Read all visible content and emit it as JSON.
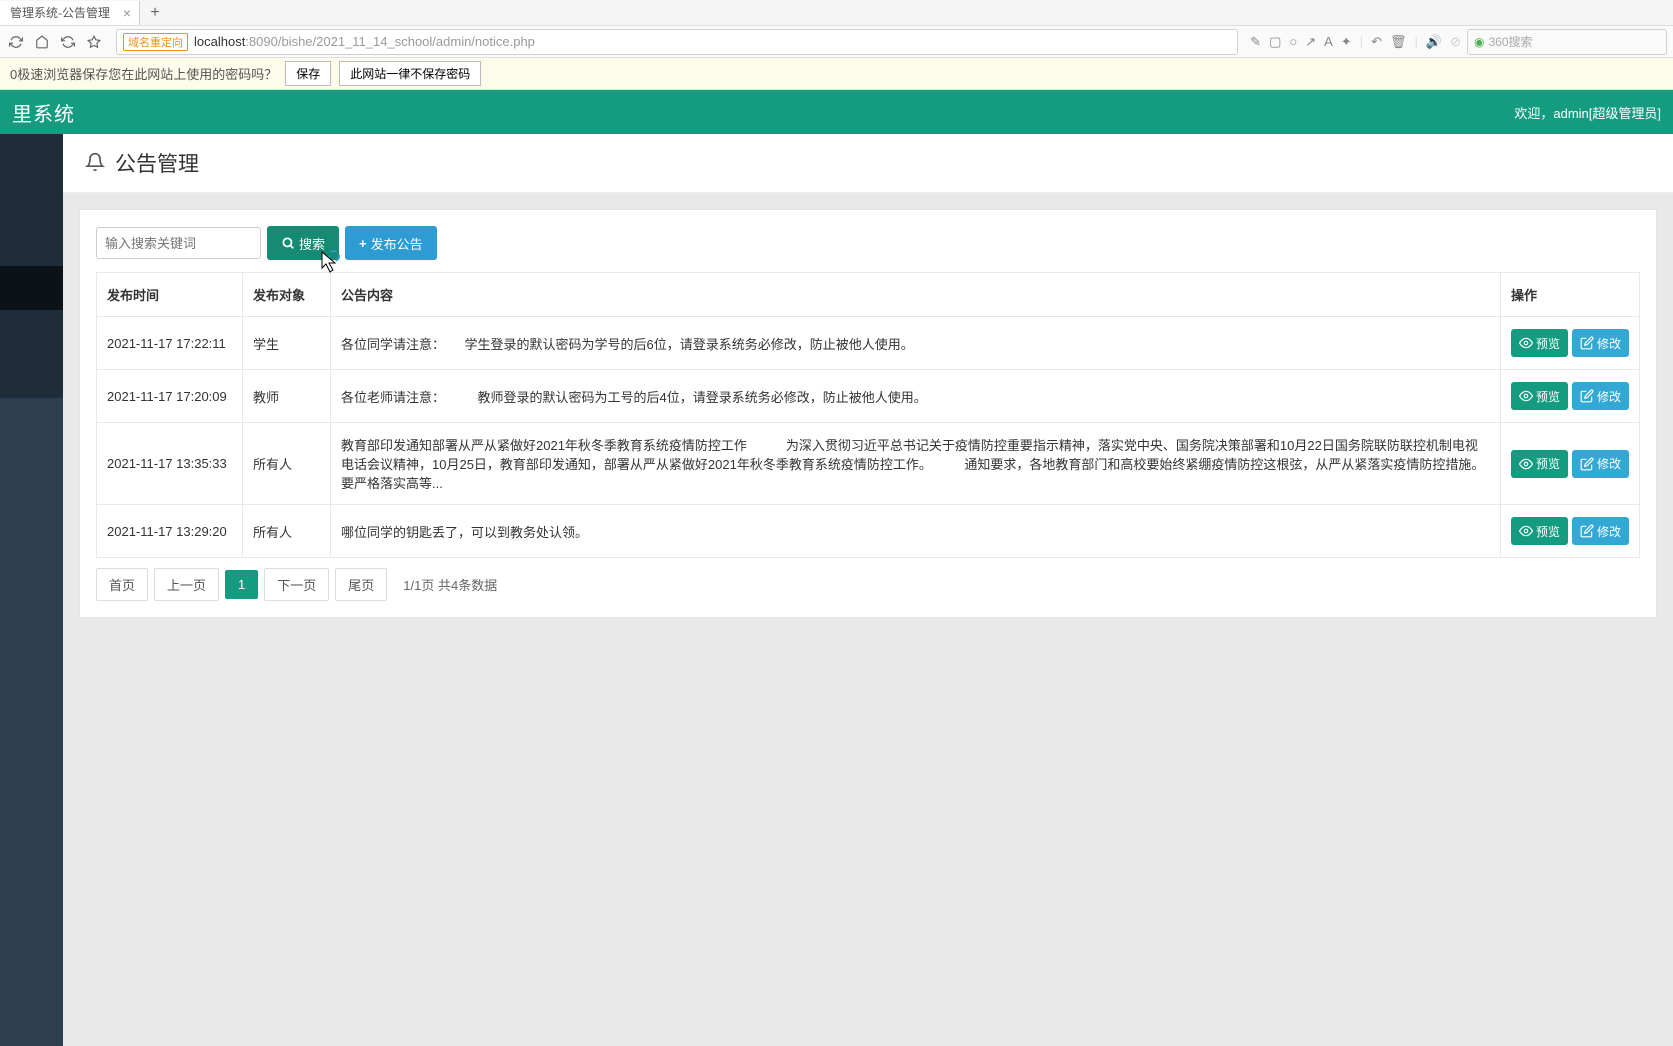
{
  "browser": {
    "tab_title": "管理系统-公告管理",
    "url_badge": "域名重定向",
    "url_host": "localhost",
    "url_path": ":8090/bishe/2021_11_14_school/admin/notice.php",
    "search_placeholder": "360搜索"
  },
  "password_bar": {
    "prompt": "0极速浏览器保存您在此网站上使用的密码吗？",
    "save": "保存",
    "never": "此网站一律不保存密码"
  },
  "header": {
    "logo": "里系统",
    "welcome": "欢迎，admin[超级管理员]"
  },
  "page": {
    "title": "公告管理",
    "search_placeholder": "输入搜索关键词",
    "btn_search": "搜索",
    "btn_publish": "发布公告"
  },
  "table": {
    "headers": {
      "time": "发布时间",
      "target": "发布对象",
      "content": "公告内容",
      "action": "操作"
    },
    "btn_preview": "预览",
    "btn_edit": "修改",
    "rows": [
      {
        "time": "2021-11-17 17:22:11",
        "target": "学生",
        "content": "各位同学请注意：　　学生登录的默认密码为学号的后6位，请登录系统务必修改，防止被他人使用。"
      },
      {
        "time": "2021-11-17 17:20:09",
        "target": "教师",
        "content": "各位老师请注意：　　　教师登录的默认密码为工号的后4位，请登录系统务必修改，防止被他人使用。"
      },
      {
        "time": "2021-11-17 13:35:33",
        "target": "所有人",
        "content": "教育部印发通知部署从严从紧做好2021年秋冬季教育系统疫情防控工作　　　为深入贯彻习近平总书记关于疫情防控重要指示精神，落实党中央、国务院决策部署和10月22日国务院联防联控机制电视电话会议精神，10月25日，教育部印发通知，部署从严从紧做好2021年秋冬季教育系统疫情防控工作。　　　通知要求，各地教育部门和高校要始终紧绷疫情防控这根弦，从严从紧落实疫情防控措施。要严格落实高等..."
      },
      {
        "time": "2021-11-17 13:29:20",
        "target": "所有人",
        "content": "哪位同学的钥匙丢了，可以到教务处认领。"
      }
    ]
  },
  "pagination": {
    "first": "首页",
    "prev": "上一页",
    "current": "1",
    "next": "下一页",
    "last": "尾页",
    "info": "1/1页 共4条数据"
  }
}
